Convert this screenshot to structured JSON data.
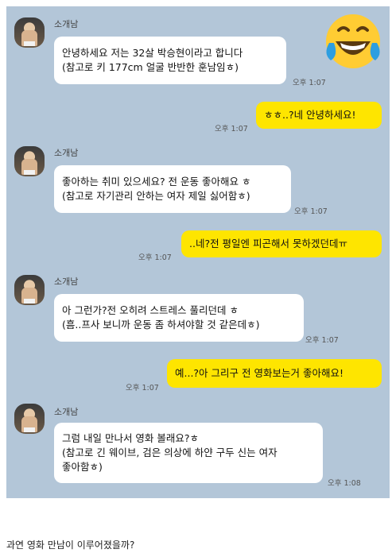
{
  "chat": {
    "messages": [
      {
        "sender": "소개남",
        "lines": [
          "안녕하세요 저는 32살 박승현이라고 합니다",
          "(참고로 키 177cm 얼굴 반반한 훈남임ㅎ)"
        ],
        "time": "오후 1:07"
      },
      {
        "lines": [
          "ㅎㅎ..?네 안녕하세요!"
        ],
        "time": "오후 1:07"
      },
      {
        "sender": "소개남",
        "lines": [
          "좋아하는 취미 있으세요? 전 운동 좋아해요 ㅎ",
          "(참고로 자기관리 안하는 여자 제일 싫어함ㅎ)"
        ],
        "time": "오후 1:07"
      },
      {
        "lines": [
          "..네?전 평일엔 피곤해서 못하겠던데ㅠ"
        ],
        "time": "오후 1:07"
      },
      {
        "sender": "소개남",
        "lines": [
          "아 그런가?전 오히려 스트레스 풀리던데 ㅎ",
          "(흠..프사 보니까 운동 좀 하셔야할 것 같은데ㅎ)"
        ],
        "time": "오후 1:07"
      },
      {
        "lines": [
          "예...?아 그리구 전 영화보는거 좋아해요!"
        ],
        "time": "오후 1:07"
      },
      {
        "sender": "소개남",
        "lines": [
          "그럼 내일 만나서 영화 볼래요?ㅎ",
          "(참고로 긴 웨이브, 검은 의상에 하얀 구두 신는 여자",
          "좋아함ㅎ)"
        ],
        "time": "오후 1:08"
      }
    ]
  },
  "emoji": "laughing-with-tears",
  "caption": "과연 영화 만남이 이루어졌을까?",
  "colors": {
    "background": "#b3c6d8",
    "incoming": "#ffffff",
    "outgoing": "#fee500"
  }
}
